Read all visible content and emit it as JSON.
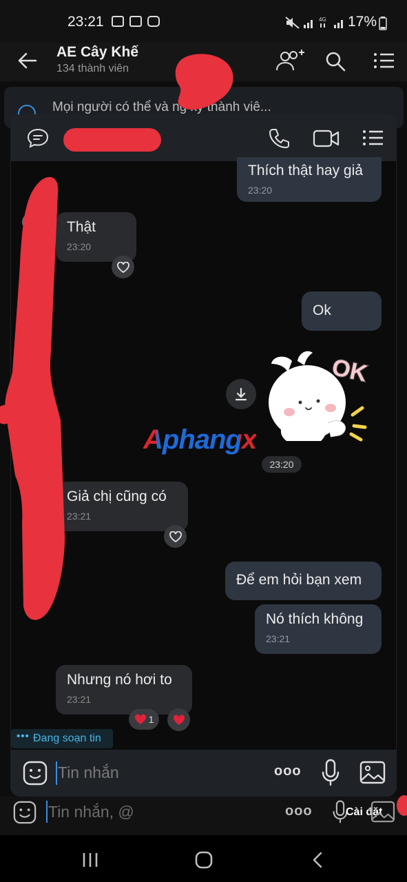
{
  "status_bar": {
    "time": "23:21",
    "battery": "17%"
  },
  "group": {
    "name": "AE Cây Khế",
    "members": "134 thành viên",
    "pinned_text": "Mọi người có thể và   ng ký thành viê..."
  },
  "chat": {
    "messages": [
      {
        "text": "Thích thật hay giả",
        "time": "23:20"
      },
      {
        "text": "Thật",
        "time": "23:20"
      },
      {
        "text": "Ok"
      },
      {
        "time": "23:20"
      },
      {
        "text": "Giả chị cũng có",
        "time": "23:21"
      },
      {
        "text": "Để em hỏi bạn xem"
      },
      {
        "text": "Nó thích không",
        "time": "23:21"
      },
      {
        "text": "Nhưng nó hơi to",
        "time": "23:21"
      }
    ],
    "reaction_count": "1",
    "sticker_text": "OK",
    "watermark": "Aphangx",
    "typing_label": "Đang soạn tin",
    "typing_dots": "•••",
    "composer_placeholder": "Tin nhắn",
    "more_dots": "ooo"
  },
  "bottom": {
    "composer_placeholder": "Tin nhắn, @",
    "settings_label": "Cài đặt",
    "more_dots": "ooo"
  },
  "colors": {
    "accent": "#45b6e6",
    "scribble": "#e8323e",
    "bubble_in": "#2a2b2f",
    "bubble_out": "#2e3641"
  }
}
